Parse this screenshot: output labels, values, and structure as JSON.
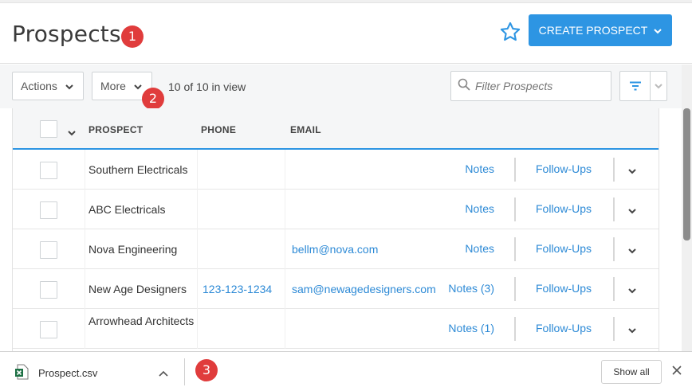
{
  "header": {
    "title": "Prospects",
    "create_label": "CREATE PROSPECT",
    "star_icon": "star-outline-icon",
    "accent": "#2d95e3"
  },
  "markers": [
    "1",
    "2",
    "3"
  ],
  "toolbar": {
    "actions_label": "Actions",
    "more_label": "More",
    "count_text": "10 of 10 in view",
    "filter_placeholder": "Filter Prospects"
  },
  "table": {
    "columns": [
      "PROSPECT",
      "PHONE",
      "EMAIL"
    ],
    "rows": [
      {
        "name": "Southern Electricals",
        "phone": "",
        "email": "",
        "notes": "Notes",
        "followups": "Follow-Ups"
      },
      {
        "name": "ABC Electricals",
        "phone": "",
        "email": "",
        "notes": "Notes",
        "followups": "Follow-Ups"
      },
      {
        "name": "Nova Engineering",
        "phone": "",
        "email": "bellm@nova.com",
        "notes": "Notes",
        "followups": "Follow-Ups"
      },
      {
        "name": "New Age Designers",
        "phone": "123-123-1234",
        "email": "sam@newagedesigners.com",
        "notes": "Notes (3)",
        "followups": "Follow-Ups"
      },
      {
        "name": "Arrowhead Architects",
        "phone": "",
        "email": "",
        "notes": "Notes (1)",
        "followups": "Follow-Ups"
      }
    ]
  },
  "download_bar": {
    "file_name": "Prospect.csv",
    "file_icon": "excel-file-icon",
    "show_all_label": "Show all"
  }
}
